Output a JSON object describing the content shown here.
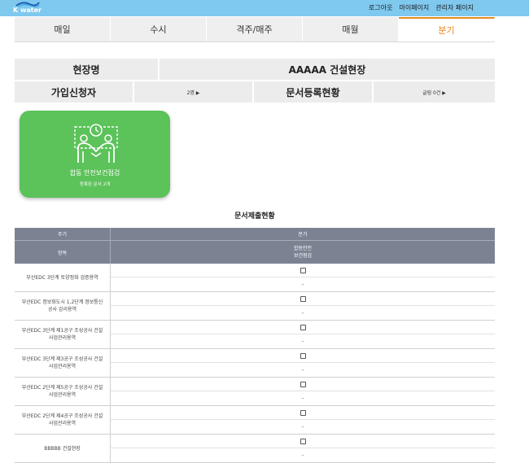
{
  "brand": {
    "name": "K water"
  },
  "toplinks": [
    "로그아웃",
    "마이페이지",
    "관리자 페이지"
  ],
  "tabs": [
    "매일",
    "수시",
    "격주/매주",
    "매월",
    "분기"
  ],
  "active_tab": "분기",
  "info": {
    "site_label": "현장명",
    "site_value": "AAAAA 건설현장",
    "applicant_label": "가입신청자",
    "applicant_value": "2명 ▶",
    "doc_label": "문서등록현황",
    "doc_value": "글림 0건 ▶"
  },
  "card": {
    "title": "합동 안전보건점검",
    "subtitle": "등록된 문서 2개",
    "icon": "handshake-icon"
  },
  "section_title": "문서제출현황",
  "table": {
    "header1": {
      "left": "주기",
      "right": "분기"
    },
    "header2": {
      "left": "항목",
      "right": "합동안전\n보건점검"
    },
    "rows": [
      {
        "name": "부산EDC 3단계 토양정화 검증용역",
        "mark": "-"
      },
      {
        "name": "부산EDC 정보화도시 1,2단계 정보통신공사 감리용역",
        "mark": "-"
      },
      {
        "name": "부산EDC 3단계 제1공구 조성공사 건설사업관리용역",
        "mark": "-"
      },
      {
        "name": "부산EDC 3단계 제3공구 조성공사 건설사업관리용역",
        "mark": "-"
      },
      {
        "name": "부산EDC 2단계 제5공구 조성공사 건설사업관리용역",
        "mark": "-"
      },
      {
        "name": "부산EDC 2단계 제4공구 조성공사 건설사업관리용역",
        "mark": "-"
      },
      {
        "name": "BBBBB 건설현장",
        "mark": "-"
      }
    ]
  },
  "colors": {
    "topbar": "#7fc8ee",
    "active_tab": "#e88a22",
    "card": "#5cc25a",
    "table_header": "#7b8393"
  }
}
